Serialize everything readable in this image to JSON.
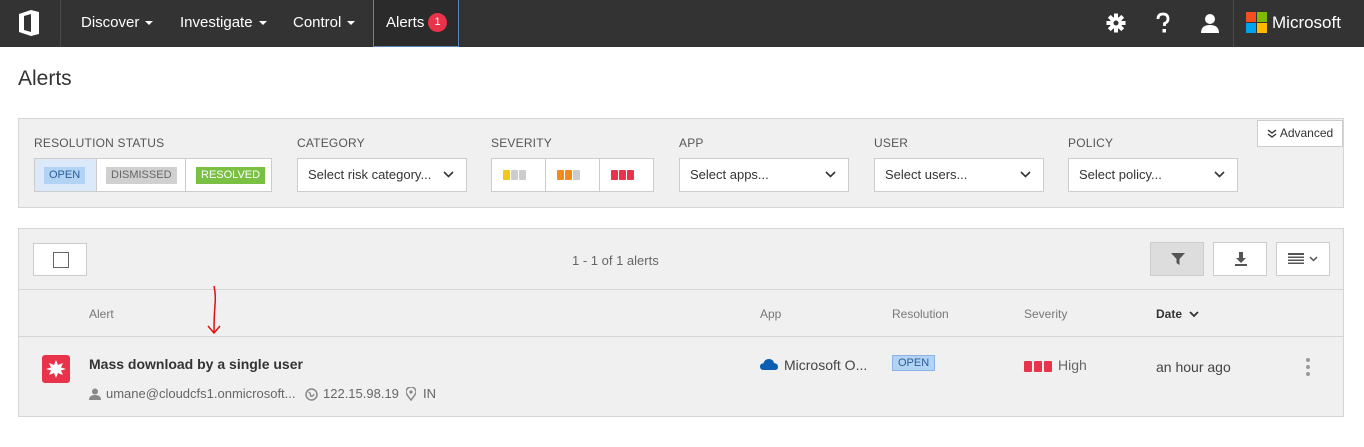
{
  "topnav": {
    "items": [
      {
        "label": "Discover"
      },
      {
        "label": "Investigate"
      },
      {
        "label": "Control"
      }
    ],
    "alerts": {
      "label": "Alerts",
      "badge": "1"
    },
    "brand": "Microsoft",
    "icons": [
      "office-logo-icon",
      "settings-gear-icon",
      "help-question-icon",
      "user-icon",
      "microsoft-logo-icon"
    ]
  },
  "page": {
    "title": "Alerts"
  },
  "filters": {
    "resolution": {
      "label": "RESOLUTION STATUS",
      "options": [
        "OPEN",
        "DISMISSED",
        "RESOLVED"
      ]
    },
    "category": {
      "label": "CATEGORY",
      "placeholder": "Select risk category..."
    },
    "severity": {
      "label": "SEVERITY"
    },
    "app": {
      "label": "APP",
      "placeholder": "Select apps..."
    },
    "user": {
      "label": "USER",
      "placeholder": "Select users..."
    },
    "policy": {
      "label": "POLICY",
      "placeholder": "Select policy..."
    },
    "advanced": "Advanced"
  },
  "list": {
    "count": "1 - 1 of 1 alerts",
    "columns": {
      "alert": "Alert",
      "app": "App",
      "resolution": "Resolution",
      "severity": "Severity",
      "date": "Date"
    },
    "rows": [
      {
        "title": "Mass download by a single user",
        "user": "umane@cloudcfs1.onmicrosoft...",
        "ip": "122.15.98.19",
        "location": "IN",
        "app": "Microsoft O...",
        "resolution": "OPEN",
        "severity": "High",
        "date": "an hour ago"
      }
    ]
  },
  "colors": {
    "topbar": "#333333",
    "accent_red": "#e8334a",
    "open_blue": "#b3d3f5",
    "dismissed_gray": "#d0d0d0",
    "resolved_green": "#7ac143",
    "low_yellow": "#f5c518",
    "medium_orange": "#f08c1e"
  }
}
